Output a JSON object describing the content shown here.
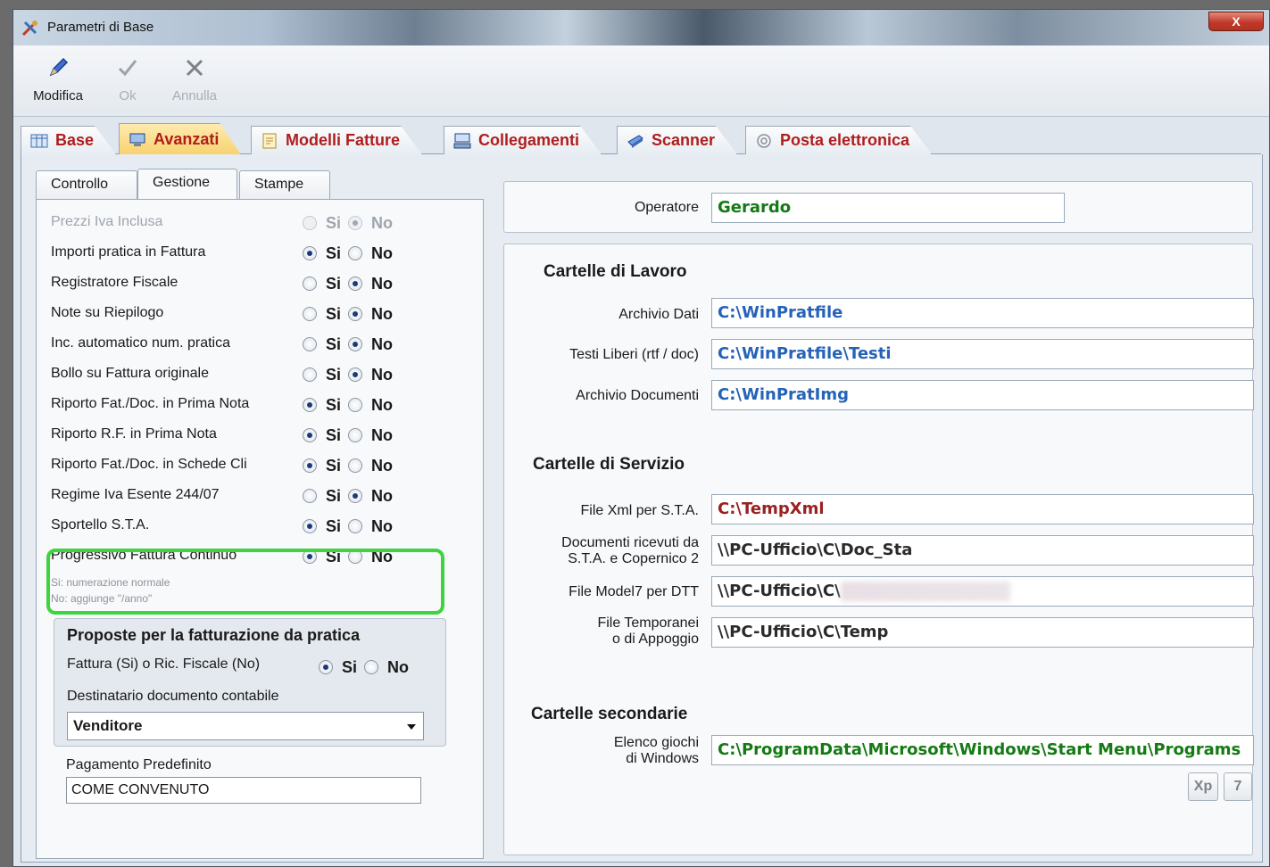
{
  "window": {
    "title": "Parametri di Base",
    "close_label": "X"
  },
  "toolbar": {
    "modifica": "Modifica",
    "ok": "Ok",
    "annulla": "Annulla"
  },
  "tabs": [
    {
      "label": "Base"
    },
    {
      "label": "Avanzati"
    },
    {
      "label": "Modelli Fatture"
    },
    {
      "label": "Collegamenti"
    },
    {
      "label": "Scanner"
    },
    {
      "label": "Posta elettronica"
    }
  ],
  "subtabs": [
    {
      "label": "Controllo"
    },
    {
      "label": "Gestione"
    },
    {
      "label": "Stampe"
    }
  ],
  "radio": {
    "si": "Si",
    "no": "No"
  },
  "options": [
    {
      "label": "Prezzi Iva Inclusa",
      "value": "No",
      "enabled": false
    },
    {
      "label": "Importi pratica in Fattura",
      "value": "Si",
      "enabled": true
    },
    {
      "label": "Registratore Fiscale",
      "value": "No",
      "enabled": true
    },
    {
      "label": "Note su Riepilogo",
      "value": "No",
      "enabled": true
    },
    {
      "label": "Inc. automatico num. pratica",
      "value": "No",
      "enabled": true
    },
    {
      "label": "Bollo su Fattura originale",
      "value": "No",
      "enabled": true
    },
    {
      "label": "Riporto Fat./Doc. in Prima Nota",
      "value": "Si",
      "enabled": true
    },
    {
      "label": "Riporto R.F. in Prima Nota",
      "value": "Si",
      "enabled": true
    },
    {
      "label": "Riporto Fat./Doc. in Schede Cli",
      "value": "Si",
      "enabled": true
    },
    {
      "label": "Regime Iva Esente 244/07",
      "value": "No",
      "enabled": true
    },
    {
      "label": "Sportello S.T.A.",
      "value": "Si",
      "enabled": true
    },
    {
      "label": "Progressivo Fattura Continuo",
      "value": "Si",
      "enabled": true
    }
  ],
  "progressivo_hints": {
    "si": "Si: numerazione normale",
    "no": "No: aggiunge \"/anno\""
  },
  "proposte": {
    "title": "Proposte per la fatturazione da pratica",
    "fattura_label": "Fattura (Si) o Ric. Fiscale (No)",
    "fattura_value": "Si",
    "destinatario_label": "Destinatario documento contabile",
    "destinatario_value": "Venditore"
  },
  "pagamento": {
    "label": "Pagamento Predefinito",
    "value": "COME CONVENUTO"
  },
  "operatore": {
    "label": "Operatore",
    "value": "Gerardo"
  },
  "lavoro": {
    "title": "Cartelle di Lavoro",
    "archivio_dati_label": "Archivio Dati",
    "archivio_dati": "C:\\WinPratfile",
    "testi_label": "Testi Liberi (rtf / doc)",
    "testi": "C:\\WinPratfile\\Testi",
    "documenti_label": "Archivio Documenti",
    "documenti": "C:\\WinPratImg"
  },
  "servizio": {
    "title": "Cartelle di Servizio",
    "xml_label": "File Xml per S.T.A.",
    "xml": "C:\\TempXml",
    "ricevuti_label_1": "Documenti ricevuti da",
    "ricevuti_label_2": "S.T.A.  e Copernico 2",
    "ricevuti": "\\\\PC-Ufficio\\C\\Doc_Sta",
    "model7_label": "File Model7 per DTT",
    "model7": "\\\\PC-Ufficio\\C\\",
    "temp_label_1": "File Temporanei",
    "temp_label_2": "o di Appoggio",
    "temp": "\\\\PC-Ufficio\\C\\Temp"
  },
  "secondarie": {
    "title": "Cartelle secondarie",
    "giochi_label_1": "Elenco giochi",
    "giochi_label_2": "di Windows",
    "giochi": "C:\\ProgramData\\Microsoft\\Windows\\Start Menu\\Programs",
    "btn_xp": "Xp",
    "btn_7": "7"
  },
  "colors": {
    "accent_green": "#3fd33f",
    "tab_text": "#b01d1d",
    "path_blue": "#2563b8",
    "operator_green": "#147a14"
  }
}
